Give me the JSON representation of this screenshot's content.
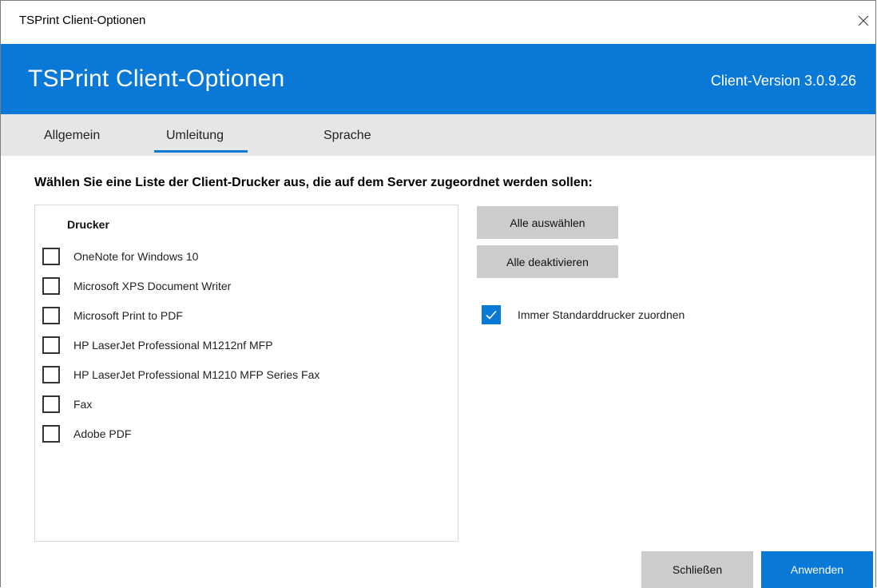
{
  "window": {
    "title": "TSPrint Client-Optionen"
  },
  "header": {
    "title": "TSPrint Client-Optionen",
    "version": "Client-Version 3.0.9.26"
  },
  "tabs": [
    {
      "label": "Allgemein",
      "active": false
    },
    {
      "label": "Umleitung",
      "active": true
    },
    {
      "label": "Sprache",
      "active": false
    }
  ],
  "instruction": "Wählen Sie eine Liste der Client-Drucker aus, die auf dem Server zugeordnet werden sollen:",
  "printer_list": {
    "column_header": "Drucker",
    "items": [
      {
        "label": "OneNote for Windows 10",
        "checked": false
      },
      {
        "label": "Microsoft XPS Document Writer",
        "checked": false
      },
      {
        "label": "Microsoft Print to PDF",
        "checked": false
      },
      {
        "label": "HP LaserJet Professional M1212nf MFP",
        "checked": false
      },
      {
        "label": "HP LaserJet Professional M1210 MFP Series Fax",
        "checked": false
      },
      {
        "label": "Fax",
        "checked": false
      },
      {
        "label": "Adobe PDF",
        "checked": false
      }
    ]
  },
  "actions": {
    "select_all": "Alle auswählen",
    "deselect_all": "Alle deaktivieren"
  },
  "default_printer": {
    "label": "Immer Standarddrucker zuordnen",
    "checked": true
  },
  "footer": {
    "close_label": "Schließen",
    "apply_label": "Anwenden"
  },
  "colors": {
    "accent": "#0a78d7",
    "button_gray": "#cccccc",
    "tabbar": "#e6e6e6"
  },
  "icons": {
    "close": "close-icon",
    "check": "checkmark-icon"
  }
}
